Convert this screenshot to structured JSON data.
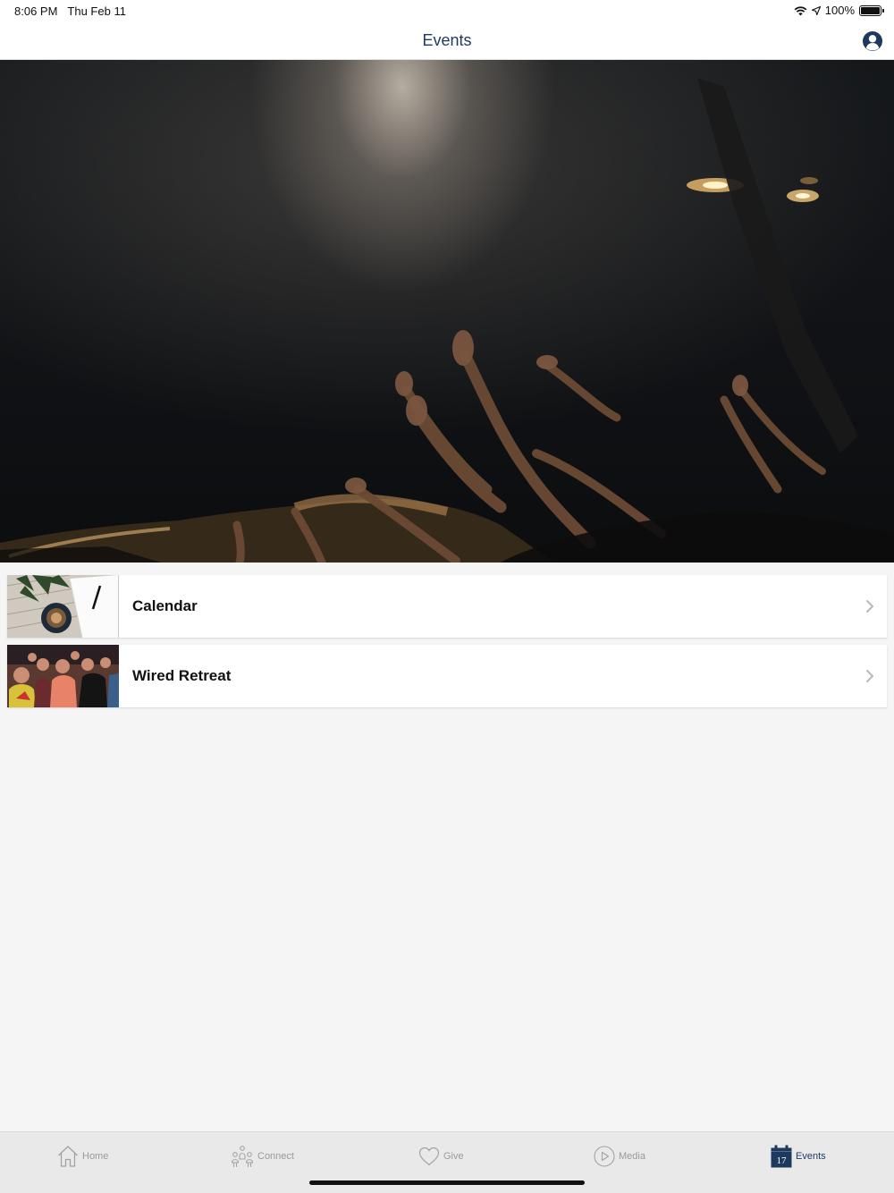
{
  "status_bar": {
    "time": "8:06 PM",
    "date": "Thu Feb 11",
    "battery": "100%",
    "icons": [
      "wifi-icon",
      "location-arrow-icon",
      "battery-icon"
    ]
  },
  "navbar": {
    "title": "Events",
    "profile_icon": "user-circle-icon"
  },
  "hero": {
    "icon": "worship-hands-photo"
  },
  "list": {
    "items": [
      {
        "label": "Calendar",
        "thumbnail": "calendar-notebook-photo",
        "chevron": "chevron-right-icon"
      },
      {
        "label": "Wired Retreat",
        "thumbnail": "retreat-crowd-photo",
        "chevron": "chevron-right-icon"
      }
    ]
  },
  "tabbar": {
    "tabs": [
      {
        "label": "Home",
        "icon": "home-icon",
        "active": false
      },
      {
        "label": "Connect",
        "icon": "people-icon",
        "active": false
      },
      {
        "label": "Give",
        "icon": "heart-icon",
        "active": false
      },
      {
        "label": "Media",
        "icon": "play-circle-icon",
        "active": false
      },
      {
        "label": "Events",
        "icon": "calendar-icon",
        "active": true,
        "icon_text": "17"
      }
    ]
  },
  "colors": {
    "accent": "#1d3a5e",
    "inactive": "#9a9a9a",
    "background": "#f5f5f5"
  }
}
